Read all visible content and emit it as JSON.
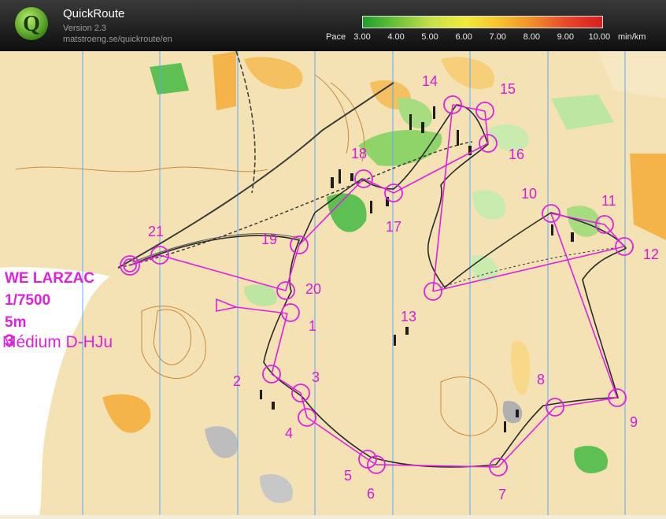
{
  "header": {
    "app_title": "QuickRoute",
    "version": "Version 2.3",
    "url": "matstroeng.se/quickroute/en",
    "pace_label": "Pace",
    "pace_unit": "min/km",
    "pace_ticks": [
      "3.00",
      "4.00",
      "5.00",
      "6.00",
      "7.00",
      "8.00",
      "9.00",
      "10.00"
    ],
    "pace_gradient_colors": [
      "#1f9e2c",
      "#6fc23a",
      "#c8e04a",
      "#f2ea3a",
      "#f6c22e",
      "#f08a2a",
      "#e8452a",
      "#d81e1e"
    ]
  },
  "map": {
    "event_name": "WE LARZAC",
    "scale": "1/7500",
    "contour": "5m",
    "course_number": "3",
    "course_name": "Médium D-HJu",
    "control_numbers": [
      "1",
      "2",
      "3",
      "4",
      "5",
      "6",
      "7",
      "8",
      "9",
      "10",
      "11",
      "12",
      "13",
      "14",
      "15",
      "16",
      "17",
      "18",
      "19",
      "20",
      "21"
    ]
  },
  "colors": {
    "overprint": "#e020e0",
    "open_land": "#f5c98a",
    "rough_open": "#f7e3b0",
    "forest_green": "#5ec052",
    "route": "#2a2a2a"
  }
}
